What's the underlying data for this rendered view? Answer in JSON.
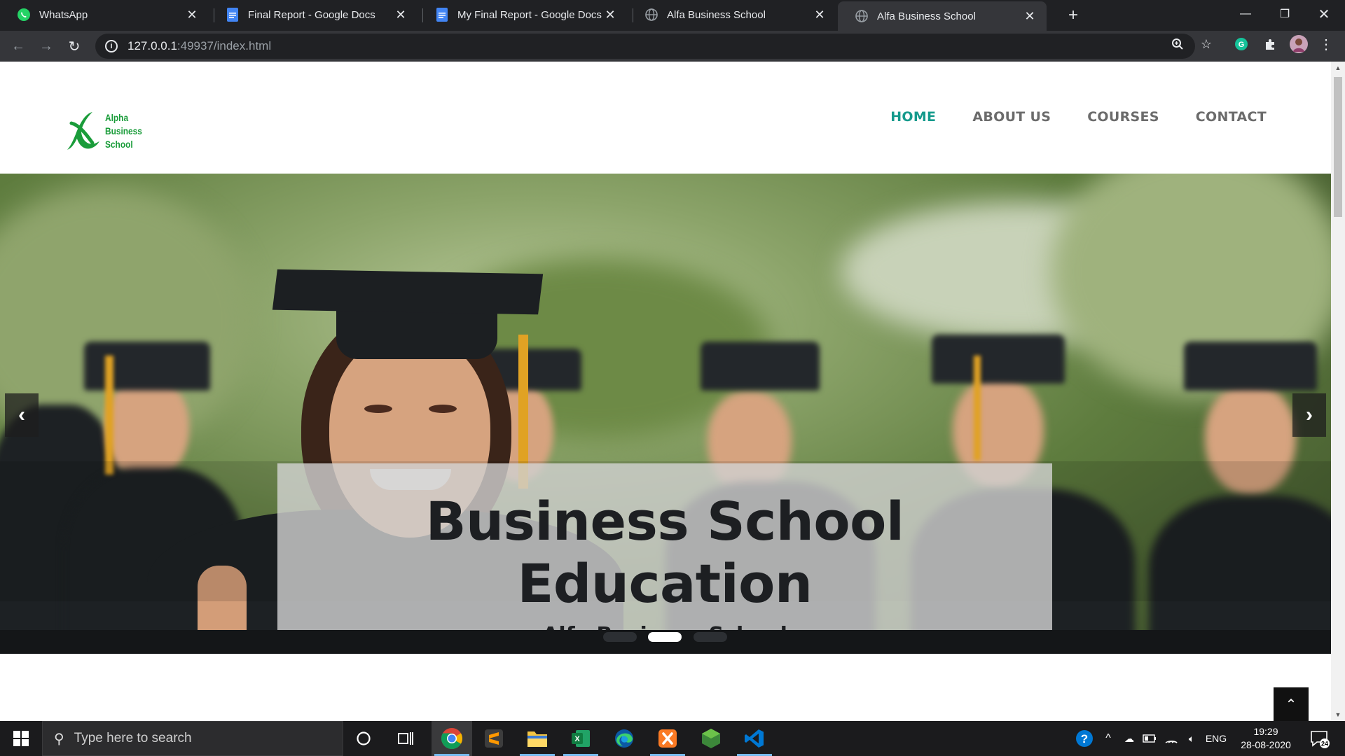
{
  "browser": {
    "tabs": [
      {
        "title": "WhatsApp",
        "icon": "whatsapp-icon",
        "active": false
      },
      {
        "title": "Final Report - Google Docs",
        "icon": "google-docs-icon",
        "active": false
      },
      {
        "title": "My Final Report - Google Docs",
        "icon": "google-docs-icon",
        "active": false
      },
      {
        "title": "Alfa Business School",
        "icon": "globe-icon",
        "active": false
      },
      {
        "title": "Alfa Business School",
        "icon": "globe-icon",
        "active": true
      }
    ],
    "url_host": "127.0.0.1",
    "url_path": ":49937/index.html"
  },
  "site": {
    "logo_lines": [
      "Alpha",
      "Business",
      "School"
    ],
    "nav": [
      {
        "label": "HOME",
        "active": true
      },
      {
        "label": "ABOUT US",
        "active": false
      },
      {
        "label": "COURSES",
        "active": false
      },
      {
        "label": "CONTACT",
        "active": false
      }
    ],
    "hero": {
      "title": "Business School Education",
      "subtitle": "Alfa Business School",
      "slide_count": 3,
      "active_slide": 2
    },
    "accent_color": "#159a8c",
    "logo_color": "#1a9c3a"
  },
  "taskbar": {
    "search_placeholder": "Type here to search",
    "language": "ENG",
    "time": "19:29",
    "date": "28-08-2020",
    "notification_count": "24"
  }
}
